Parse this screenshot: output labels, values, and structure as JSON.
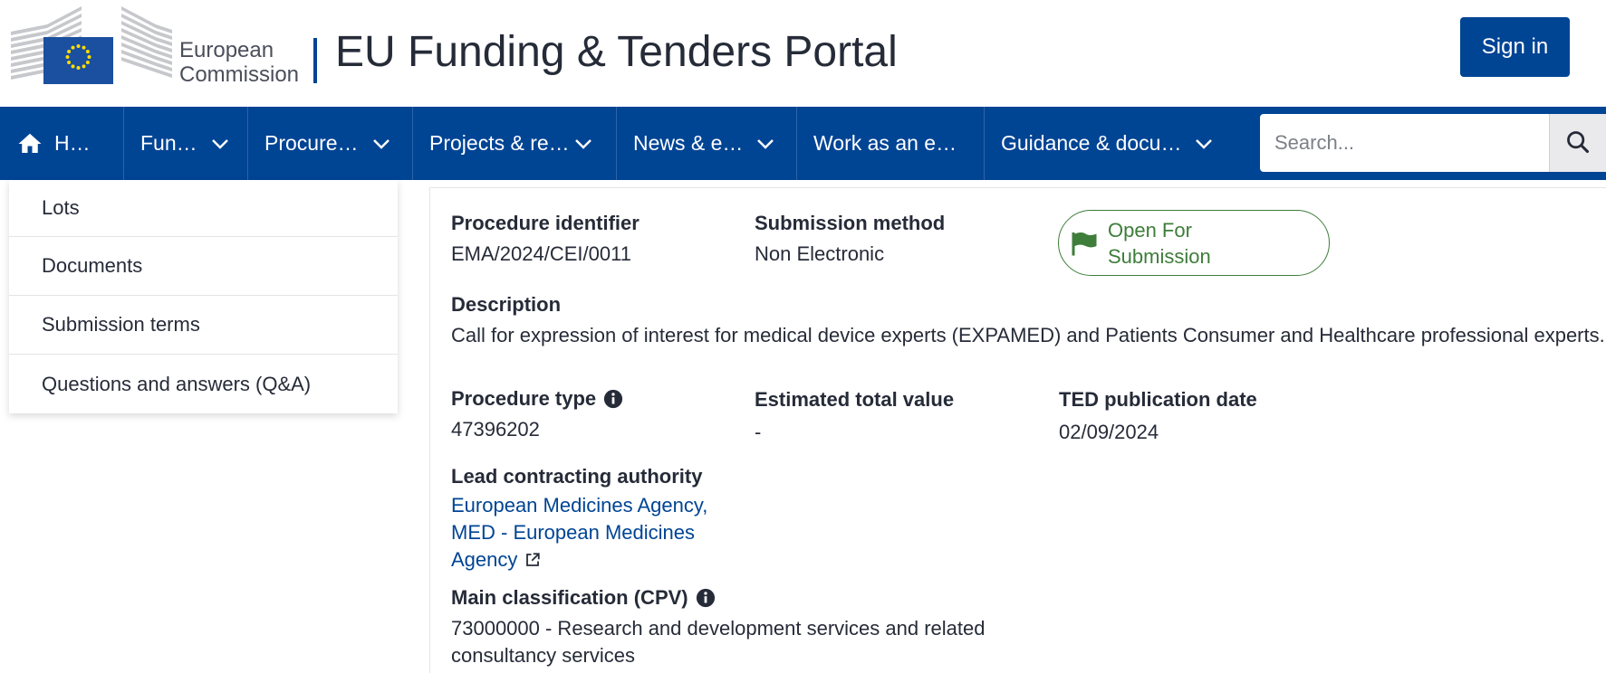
{
  "header": {
    "logo_line1": "European",
    "logo_line2": "Commission",
    "title": "EU Funding & Tenders Portal",
    "signin_label": "Sign in"
  },
  "nav": {
    "items": [
      {
        "label": "H…",
        "icon": "home-icon",
        "has_dropdown": false
      },
      {
        "label": "Fun…",
        "has_dropdown": true
      },
      {
        "label": "Procure…",
        "has_dropdown": true
      },
      {
        "label": "Projects & re…",
        "has_dropdown": true
      },
      {
        "label": "News & e…",
        "has_dropdown": true
      },
      {
        "label": "Work as an e…",
        "has_dropdown": false
      },
      {
        "label": "Guidance & docu…",
        "has_dropdown": true
      }
    ],
    "search_placeholder": "Search..."
  },
  "side_menu": {
    "items": [
      "Lots",
      "Documents",
      "Submission terms",
      "Questions and answers (Q&A)"
    ]
  },
  "details": {
    "procedure_identifier": {
      "label": "Procedure identifier",
      "value": "EMA/2024/CEI/0011"
    },
    "submission_method": {
      "label": "Submission method",
      "value": "Non Electronic"
    },
    "status": {
      "label": "Open For Submission",
      "color": "#3e7d3a"
    },
    "description": {
      "label": "Description",
      "value": "Call for expression of interest for medical device experts (EXPAMED) and Patients Consumer and Healthcare professional experts."
    },
    "procedure_type": {
      "label": "Procedure type",
      "value": "47396202"
    },
    "estimated_total_value": {
      "label": "Estimated total value",
      "value": "-"
    },
    "ted_publication_date": {
      "label": "TED publication date",
      "value": "02/09/2024"
    },
    "lead_contracting_authority": {
      "label": "Lead contracting authority",
      "value": "European Medicines Agency, MED - European Medicines Agency"
    },
    "main_classification": {
      "label": "Main classification (CPV)",
      "value": "73000000 - Research and development services and related consultancy services"
    }
  },
  "colors": {
    "brand_blue": "#004494",
    "status_green": "#3e7d3a",
    "text": "#262b38"
  }
}
